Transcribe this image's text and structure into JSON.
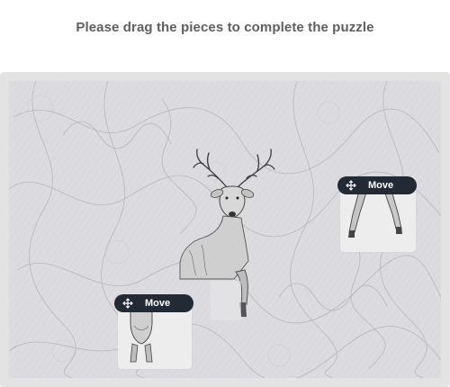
{
  "instruction": "Please drag the pieces to complete the puzzle",
  "pieces": [
    {
      "move_label": "Move",
      "icon": "move-arrows-icon"
    },
    {
      "move_label": "Move",
      "icon": "move-arrows-icon"
    }
  ],
  "colors": {
    "button_bg": "#232a36",
    "board_bg": "#d9d9de",
    "frame_bg": "#e3e3e3",
    "title_text": "#5f5f5f"
  }
}
